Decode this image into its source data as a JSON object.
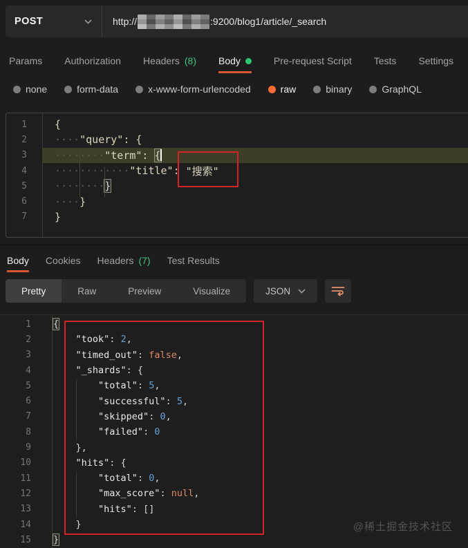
{
  "colors": {
    "accent_orange": "#ff6c37",
    "underline_orange": "#d8572e",
    "count_green": "#3fc487",
    "dot_green": "#2fc46e",
    "annotation_red": "#d32525",
    "number_blue": "#63a2da",
    "keyword_orange": "#dd8a63",
    "request_text": "#dbd5bd",
    "active_line_bg": "#3e3d27",
    "key_white": "#e9e9e9",
    "punct_gray": "#d6d6d6"
  },
  "request": {
    "method": "POST",
    "url_prefix": "http://",
    "url_redacted": "redacted-host",
    "url_suffix": ":9200/blog1/article/_search"
  },
  "request_tabs": [
    {
      "label": "Params"
    },
    {
      "label": "Authorization"
    },
    {
      "label": "Headers",
      "count": "(8)"
    },
    {
      "label": "Body",
      "active": true,
      "dot": true
    },
    {
      "label": "Pre-request Script"
    },
    {
      "label": "Tests"
    },
    {
      "label": "Settings"
    }
  ],
  "body_modes": [
    {
      "label": "none"
    },
    {
      "label": "form-data"
    },
    {
      "label": "x-www-form-urlencoded"
    },
    {
      "label": "raw",
      "selected": true
    },
    {
      "label": "binary"
    },
    {
      "label": "GraphQL"
    }
  ],
  "request_editor": {
    "active_line": 3,
    "lines": [
      {
        "segs": [
          [
            "t",
            "{"
          ]
        ]
      },
      {
        "segs": [
          [
            "ws",
            "    "
          ],
          [
            "t",
            "\"query\": {"
          ]
        ]
      },
      {
        "segs": [
          [
            "ws",
            "        "
          ],
          [
            "t",
            "\"term\": "
          ],
          [
            "bm",
            "{"
          ]
        ]
      },
      {
        "segs": [
          [
            "ws",
            "            "
          ],
          [
            "t",
            "\"title\": "
          ],
          [
            "t",
            "\"搜索\""
          ]
        ]
      },
      {
        "segs": [
          [
            "ws",
            "        "
          ],
          [
            "bm",
            "}"
          ]
        ]
      },
      {
        "segs": [
          [
            "ws",
            "    "
          ],
          [
            "t",
            "}"
          ]
        ]
      },
      {
        "segs": [
          [
            "t",
            "}"
          ]
        ]
      }
    ]
  },
  "response_tabs": [
    {
      "label": "Body",
      "active": true
    },
    {
      "label": "Cookies"
    },
    {
      "label": "Headers",
      "count": "(7)"
    },
    {
      "label": "Test Results"
    }
  ],
  "response_toolbar": {
    "views": [
      {
        "label": "Pretty",
        "active": true
      },
      {
        "label": "Raw"
      },
      {
        "label": "Preview"
      },
      {
        "label": "Visualize"
      }
    ],
    "format": "JSON"
  },
  "response_editor": {
    "lines": [
      {
        "segs": [
          [
            "bm",
            "{"
          ]
        ]
      },
      {
        "segs": [
          [
            "ws",
            "    "
          ],
          [
            "k",
            "\"took\""
          ],
          [
            "p",
            ": "
          ],
          [
            "n",
            "2"
          ],
          [
            "p",
            ","
          ]
        ]
      },
      {
        "segs": [
          [
            "ws",
            "    "
          ],
          [
            "k",
            "\"timed_out\""
          ],
          [
            "p",
            ": "
          ],
          [
            "kw",
            "false"
          ],
          [
            "p",
            ","
          ]
        ]
      },
      {
        "segs": [
          [
            "ws",
            "    "
          ],
          [
            "k",
            "\"_shards\""
          ],
          [
            "p",
            ": {"
          ]
        ]
      },
      {
        "segs": [
          [
            "ws",
            "        "
          ],
          [
            "k",
            "\"total\""
          ],
          [
            "p",
            ": "
          ],
          [
            "n",
            "5"
          ],
          [
            "p",
            ","
          ]
        ]
      },
      {
        "segs": [
          [
            "ws",
            "        "
          ],
          [
            "k",
            "\"successful\""
          ],
          [
            "p",
            ": "
          ],
          [
            "n",
            "5"
          ],
          [
            "p",
            ","
          ]
        ]
      },
      {
        "segs": [
          [
            "ws",
            "        "
          ],
          [
            "k",
            "\"skipped\""
          ],
          [
            "p",
            ": "
          ],
          [
            "n",
            "0"
          ],
          [
            "p",
            ","
          ]
        ]
      },
      {
        "segs": [
          [
            "ws",
            "        "
          ],
          [
            "k",
            "\"failed\""
          ],
          [
            "p",
            ": "
          ],
          [
            "n",
            "0"
          ]
        ]
      },
      {
        "segs": [
          [
            "ws",
            "    "
          ],
          [
            "p",
            "},"
          ]
        ]
      },
      {
        "segs": [
          [
            "ws",
            "    "
          ],
          [
            "k",
            "\"hits\""
          ],
          [
            "p",
            ": {"
          ]
        ]
      },
      {
        "segs": [
          [
            "ws",
            "        "
          ],
          [
            "k",
            "\"total\""
          ],
          [
            "p",
            ": "
          ],
          [
            "n",
            "0"
          ],
          [
            "p",
            ","
          ]
        ]
      },
      {
        "segs": [
          [
            "ws",
            "        "
          ],
          [
            "k",
            "\"max_score\""
          ],
          [
            "p",
            ": "
          ],
          [
            "kw",
            "null"
          ],
          [
            "p",
            ","
          ]
        ]
      },
      {
        "segs": [
          [
            "ws",
            "        "
          ],
          [
            "k",
            "\"hits\""
          ],
          [
            "p",
            ": []"
          ]
        ]
      },
      {
        "segs": [
          [
            "ws",
            "    "
          ],
          [
            "p",
            "}"
          ]
        ]
      },
      {
        "segs": [
          [
            "bm",
            "}"
          ]
        ]
      }
    ]
  },
  "watermark": "@稀土掘金技术社区"
}
